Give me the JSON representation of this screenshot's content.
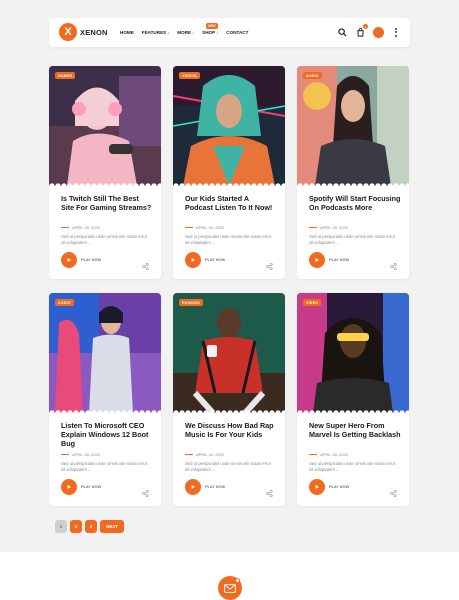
{
  "colors": {
    "accent": "#f26a1f",
    "background": "#f2f2f2",
    "card": "#ffffff"
  },
  "header": {
    "logo_letter": "X",
    "logo_text": "XENON",
    "menu": [
      {
        "label": "HOME",
        "caret": ""
      },
      {
        "label": "FEATURES",
        "caret": "↓"
      },
      {
        "label": "MORE",
        "caret": "↓"
      },
      {
        "label": "SHOP",
        "caret": "↓",
        "badge": "NEW"
      },
      {
        "label": "CONTACT",
        "caret": ""
      }
    ],
    "cart_count": "1",
    "icons": [
      "search-icon",
      "cart-icon",
      "theme-toggle-icon",
      "more-vertical-icon"
    ]
  },
  "posts": [
    {
      "tag": "GAMER",
      "title": "Is Twitch Still The Best Site For Gaming Streams?",
      "date": "APRIL 30, 2022",
      "excerpt": "Sed ut perspiciatis unde omnis iste natus error sit voluptatem ...",
      "play_label": "PLAY NOW"
    },
    {
      "tag": "VIDEOS",
      "title": "Our Kids Started A Podcast Listen To It Now!",
      "date": "APRIL 30, 2022",
      "excerpt": "Sed ut perspiciatis unde omnis iste natus error sit voluptatem ...",
      "play_label": "PLAY NOW"
    },
    {
      "tag": "AUDIO",
      "title": "Spotify Will Start Focusing On Podcasts More",
      "date": "APRIL 30, 2022",
      "excerpt": "Sed ut perspiciatis unde omnis iste natus error sit voluptatem ...",
      "play_label": "PLAY NOW"
    },
    {
      "tag": "AUDIO",
      "title": "Listen To Microsoft CEO Explain Windows 12 Boot Bug",
      "date": "APRIL 30, 2022",
      "excerpt": "Sed ut perspiciatis unde omnis iste natus error sit voluptatem ...",
      "play_label": "PLAY NOW"
    },
    {
      "tag": "RANKING",
      "title": "We Discuss How Bad Rap Music Is For Your Kids",
      "date": "APRIL 30, 2022",
      "excerpt": "Sed ut perspiciatis unde omnis iste natus error sit voluptatem ...",
      "play_label": "PLAY NOW"
    },
    {
      "tag": "VIDEO",
      "title": "New Super Hero From Marvel Is Getting Backlash",
      "date": "APRIL 30, 2022",
      "excerpt": "Sed ut perspiciatis unde omnis iste natus error sit voluptatem ...",
      "play_label": "PLAY NOW"
    }
  ],
  "pagination": {
    "pages": [
      "1",
      "2",
      "3"
    ],
    "current": "1",
    "next_label": "NEXT"
  },
  "floating_button": {
    "icon": "mail-icon"
  }
}
